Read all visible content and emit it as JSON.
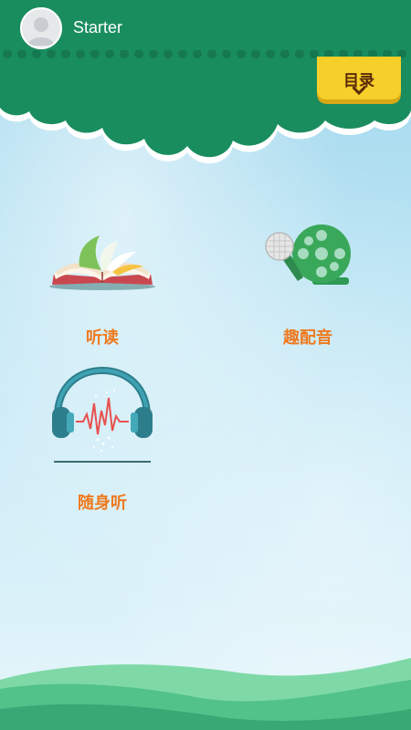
{
  "header": {
    "username": "Starter",
    "menu_label": "目录"
  },
  "main": {
    "items": [
      {
        "label": "听读",
        "icon": "open-book-icon"
      },
      {
        "label": "趣配音",
        "icon": "film-reel-microphone-icon"
      },
      {
        "label": "随身听",
        "icon": "headphones-icon"
      }
    ]
  },
  "colors": {
    "header_green": "#1a8d5f",
    "menu_yellow": "#f6cf2a",
    "label_orange": "#ee7a1f",
    "hill_green": "#4fc08d"
  }
}
